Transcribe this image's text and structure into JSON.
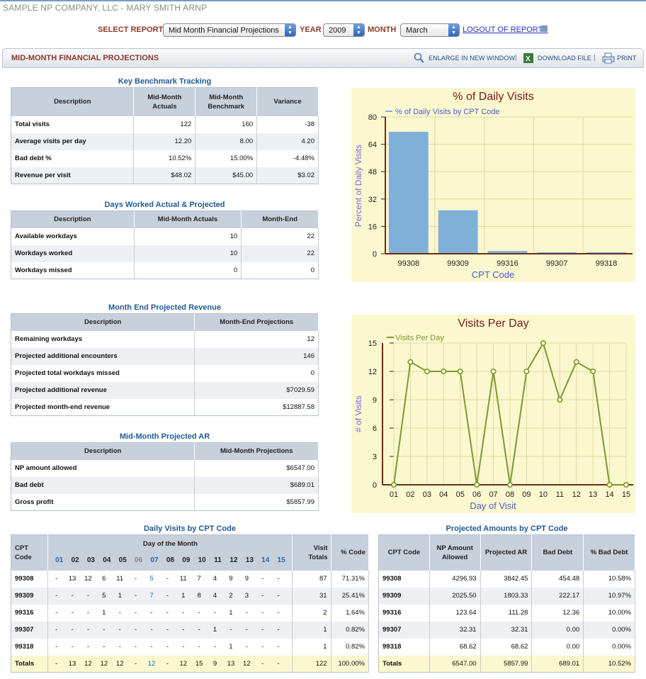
{
  "company": "SAMPLE NP COMPANY, LLC  -  MARY SMITH ARNP",
  "controls": {
    "report_label": "SELECT REPORT",
    "report_value": "Mid Month Financial Projections",
    "year_label": "YEAR",
    "year_value": "2009",
    "month_label": "MONTH",
    "month_value": "March",
    "logout": "LOGOUT OF REPORTS"
  },
  "header": {
    "title": "MID-MONTH FINANCIAL PROJECTIONS",
    "enlarge": "ENLARGE IN NEW WINDOW",
    "download": "DOWNLOAD FILE",
    "print": "PRINT",
    "sep": "|"
  },
  "benchmark": {
    "title": "Key Benchmark Tracking",
    "cols": [
      "Description",
      "Mid-Month Actuals",
      "Mid-Month Benchmark",
      "Variance"
    ],
    "rows": [
      [
        "Total visits",
        "122",
        "160",
        "-38"
      ],
      [
        "Average visits per day",
        "12.20",
        "8.00",
        "4.20"
      ],
      [
        "Bad debt %",
        "10.52%",
        "15.00%",
        "-4.48%"
      ],
      [
        "Revenue per visit",
        "$48.02",
        "$45.00",
        "$3.02"
      ]
    ]
  },
  "days": {
    "title": "Days Worked Actual & Projected",
    "cols": [
      "Description",
      "Mid-Month Actuals",
      "Month-End"
    ],
    "rows": [
      [
        "Available workdays",
        "10",
        "22"
      ],
      [
        "Workdays worked",
        "10",
        "22"
      ],
      [
        "Workdays missed",
        "0",
        "0"
      ]
    ]
  },
  "revenue": {
    "title": "Month End Projected Revenue",
    "cols": [
      "Description",
      "Month-End Projections"
    ],
    "rows": [
      [
        "Remaining workdays",
        "12"
      ],
      [
        "Projected additional encounters",
        "146"
      ],
      [
        "Projected total workdays missed",
        "0"
      ],
      [
        "Projected additional revenue",
        "$7029.59"
      ],
      [
        "Projected month-end revenue",
        "$12887.58"
      ]
    ]
  },
  "ar": {
    "title": "Mid-Month Projected AR",
    "cols": [
      "Description",
      "Mid-Month Projections"
    ],
    "rows": [
      [
        "NP amount allowed",
        "$6547.00"
      ],
      [
        "Bad debt",
        "$689.01"
      ],
      [
        "Gross profit",
        "$5857.99"
      ]
    ]
  },
  "daily": {
    "title": "Daily Visits by CPT Code",
    "cpt_col": "CPT Code",
    "day_header": "Day of the Month",
    "totals_col": "Visit Totals",
    "pct_col": "% Code",
    "days": [
      "01",
      "02",
      "03",
      "04",
      "05",
      "06",
      "07",
      "08",
      "09",
      "10",
      "11",
      "12",
      "13",
      "14",
      "15"
    ],
    "rows": [
      {
        "code": "99308",
        "d": [
          "-",
          "13",
          "12",
          "6",
          "11",
          "-",
          "5",
          "-",
          "11",
          "7",
          "4",
          "9",
          "9",
          "-",
          "-"
        ],
        "total": "87",
        "pct": "71.31%"
      },
      {
        "code": "99309",
        "d": [
          "-",
          "-",
          "-",
          "5",
          "1",
          "-",
          "7",
          "-",
          "1",
          "8",
          "4",
          "2",
          "3",
          "-",
          "-"
        ],
        "total": "31",
        "pct": "25.41%"
      },
      {
        "code": "99316",
        "d": [
          "-",
          "-",
          "-",
          "1",
          "-",
          "-",
          "-",
          "-",
          "-",
          "-",
          "-",
          "1",
          "-",
          "-",
          "-"
        ],
        "total": "2",
        "pct": "1.64%"
      },
      {
        "code": "99307",
        "d": [
          "-",
          "-",
          "-",
          "-",
          "-",
          "-",
          "-",
          "-",
          "-",
          "-",
          "1",
          "-",
          "-",
          "-",
          "-"
        ],
        "total": "1",
        "pct": "0.82%"
      },
      {
        "code": "99318",
        "d": [
          "-",
          "-",
          "-",
          "-",
          "-",
          "-",
          "-",
          "-",
          "-",
          "-",
          "-",
          "1",
          "-",
          "-",
          "-"
        ],
        "total": "1",
        "pct": "0.82%"
      },
      {
        "code": "Totals",
        "d": [
          "-",
          "13",
          "12",
          "12",
          "12",
          "-",
          "12",
          "-",
          "12",
          "15",
          "9",
          "13",
          "12",
          "-",
          "-"
        ],
        "total": "122",
        "pct": "100.00%"
      }
    ]
  },
  "amounts": {
    "title": "Projected Amounts by CPT Code",
    "cols": [
      "CPT Code",
      "NP Amount Allowed",
      "Projected AR",
      "Bad Debt",
      "% Bad Debt"
    ],
    "rows": [
      [
        "99308",
        "4296.93",
        "3842.45",
        "454.48",
        "10.58%"
      ],
      [
        "99309",
        "2025.50",
        "1803.33",
        "222.17",
        "10.97%"
      ],
      [
        "99316",
        "123.64",
        "111.28",
        "12.36",
        "10.00%"
      ],
      [
        "99307",
        "32.31",
        "32.31",
        "0.00",
        "0.00%"
      ],
      [
        "99318",
        "68.62",
        "68.62",
        "0.00",
        "0.00%"
      ],
      [
        "Totals",
        "6547.00",
        "5857.99",
        "689.01",
        "10.52%"
      ]
    ]
  },
  "chart_data": [
    {
      "type": "bar",
      "title": "% of Daily Visits",
      "legend": "% of Daily Visits by CPT Code",
      "xlabel": "CPT Code",
      "ylabel": "Percent of Daily Visits",
      "categories": [
        "99308",
        "99309",
        "99316",
        "99307",
        "99318"
      ],
      "values": [
        71.31,
        25.41,
        1.64,
        0.82,
        0.82
      ],
      "ylim": [
        0,
        80
      ],
      "yticks": [
        "0",
        "16",
        "32",
        "48",
        "64",
        "80"
      ],
      "color": "#7fb0d8"
    },
    {
      "type": "line",
      "title": "Visits Per Day",
      "legend": "Visits Per Day",
      "xlabel": "Day of Visit",
      "ylabel": "# of Visits",
      "categories": [
        "01",
        "02",
        "03",
        "04",
        "05",
        "06",
        "07",
        "08",
        "09",
        "10",
        "11",
        "12",
        "13",
        "14",
        "15"
      ],
      "values": [
        0,
        13,
        12,
        12,
        12,
        0,
        12,
        0,
        12,
        15,
        9,
        13,
        12,
        0,
        0
      ],
      "ylim": [
        0,
        15
      ],
      "yticks": [
        "0",
        "3",
        "6",
        "9",
        "12",
        "15"
      ],
      "color": "#7a9a32"
    }
  ]
}
